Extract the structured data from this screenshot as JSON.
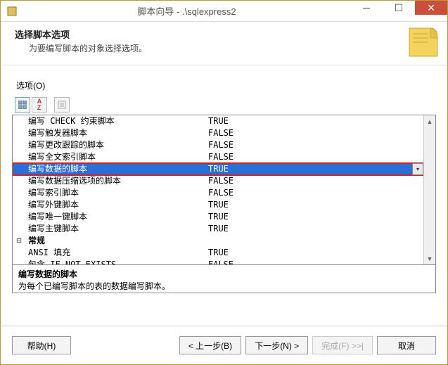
{
  "window": {
    "title": "脚本向导 - .\\sqlexpress2"
  },
  "header": {
    "title": "选择脚本选项",
    "subtitle": "为要编写脚本的对象选择选项。"
  },
  "options_label": "选项(O)",
  "grid": {
    "rows": [
      {
        "kind": "item",
        "label": "编写 CHECK 约束脚本",
        "value": "TRUE"
      },
      {
        "kind": "item",
        "label": "编写触发器脚本",
        "value": "FALSE"
      },
      {
        "kind": "item",
        "label": "编写更改跟踪的脚本",
        "value": "FALSE"
      },
      {
        "kind": "item",
        "label": "编写全文索引脚本",
        "value": "FALSE"
      },
      {
        "kind": "item",
        "label": "编写数据的脚本",
        "value": "TRUE",
        "selected": true,
        "highlighted": true,
        "dropdown": true
      },
      {
        "kind": "item",
        "label": "编写数据压缩选项的脚本",
        "value": "FALSE"
      },
      {
        "kind": "item",
        "label": "编写索引脚本",
        "value": "FALSE"
      },
      {
        "kind": "item",
        "label": "编写外键脚本",
        "value": "TRUE"
      },
      {
        "kind": "item",
        "label": "编写唯一键脚本",
        "value": "TRUE"
      },
      {
        "kind": "item",
        "label": "编写主键脚本",
        "value": "TRUE"
      },
      {
        "kind": "category",
        "label": "常规",
        "collapse_glyph": "⊟"
      },
      {
        "kind": "item",
        "label": "ANSI 填充",
        "value": "TRUE"
      },
      {
        "kind": "item",
        "label": "包含 IF NOT EXISTS",
        "value": "FALSE"
      }
    ]
  },
  "description": {
    "title": "编写数据的脚本",
    "text": "为每个已编写脚本的表的数据编写脚本。"
  },
  "buttons": {
    "help": "帮助(H)",
    "back": "< 上一步(B)",
    "next": "下一步(N) >",
    "finish": "完成(F) >>|",
    "cancel": "取消"
  }
}
